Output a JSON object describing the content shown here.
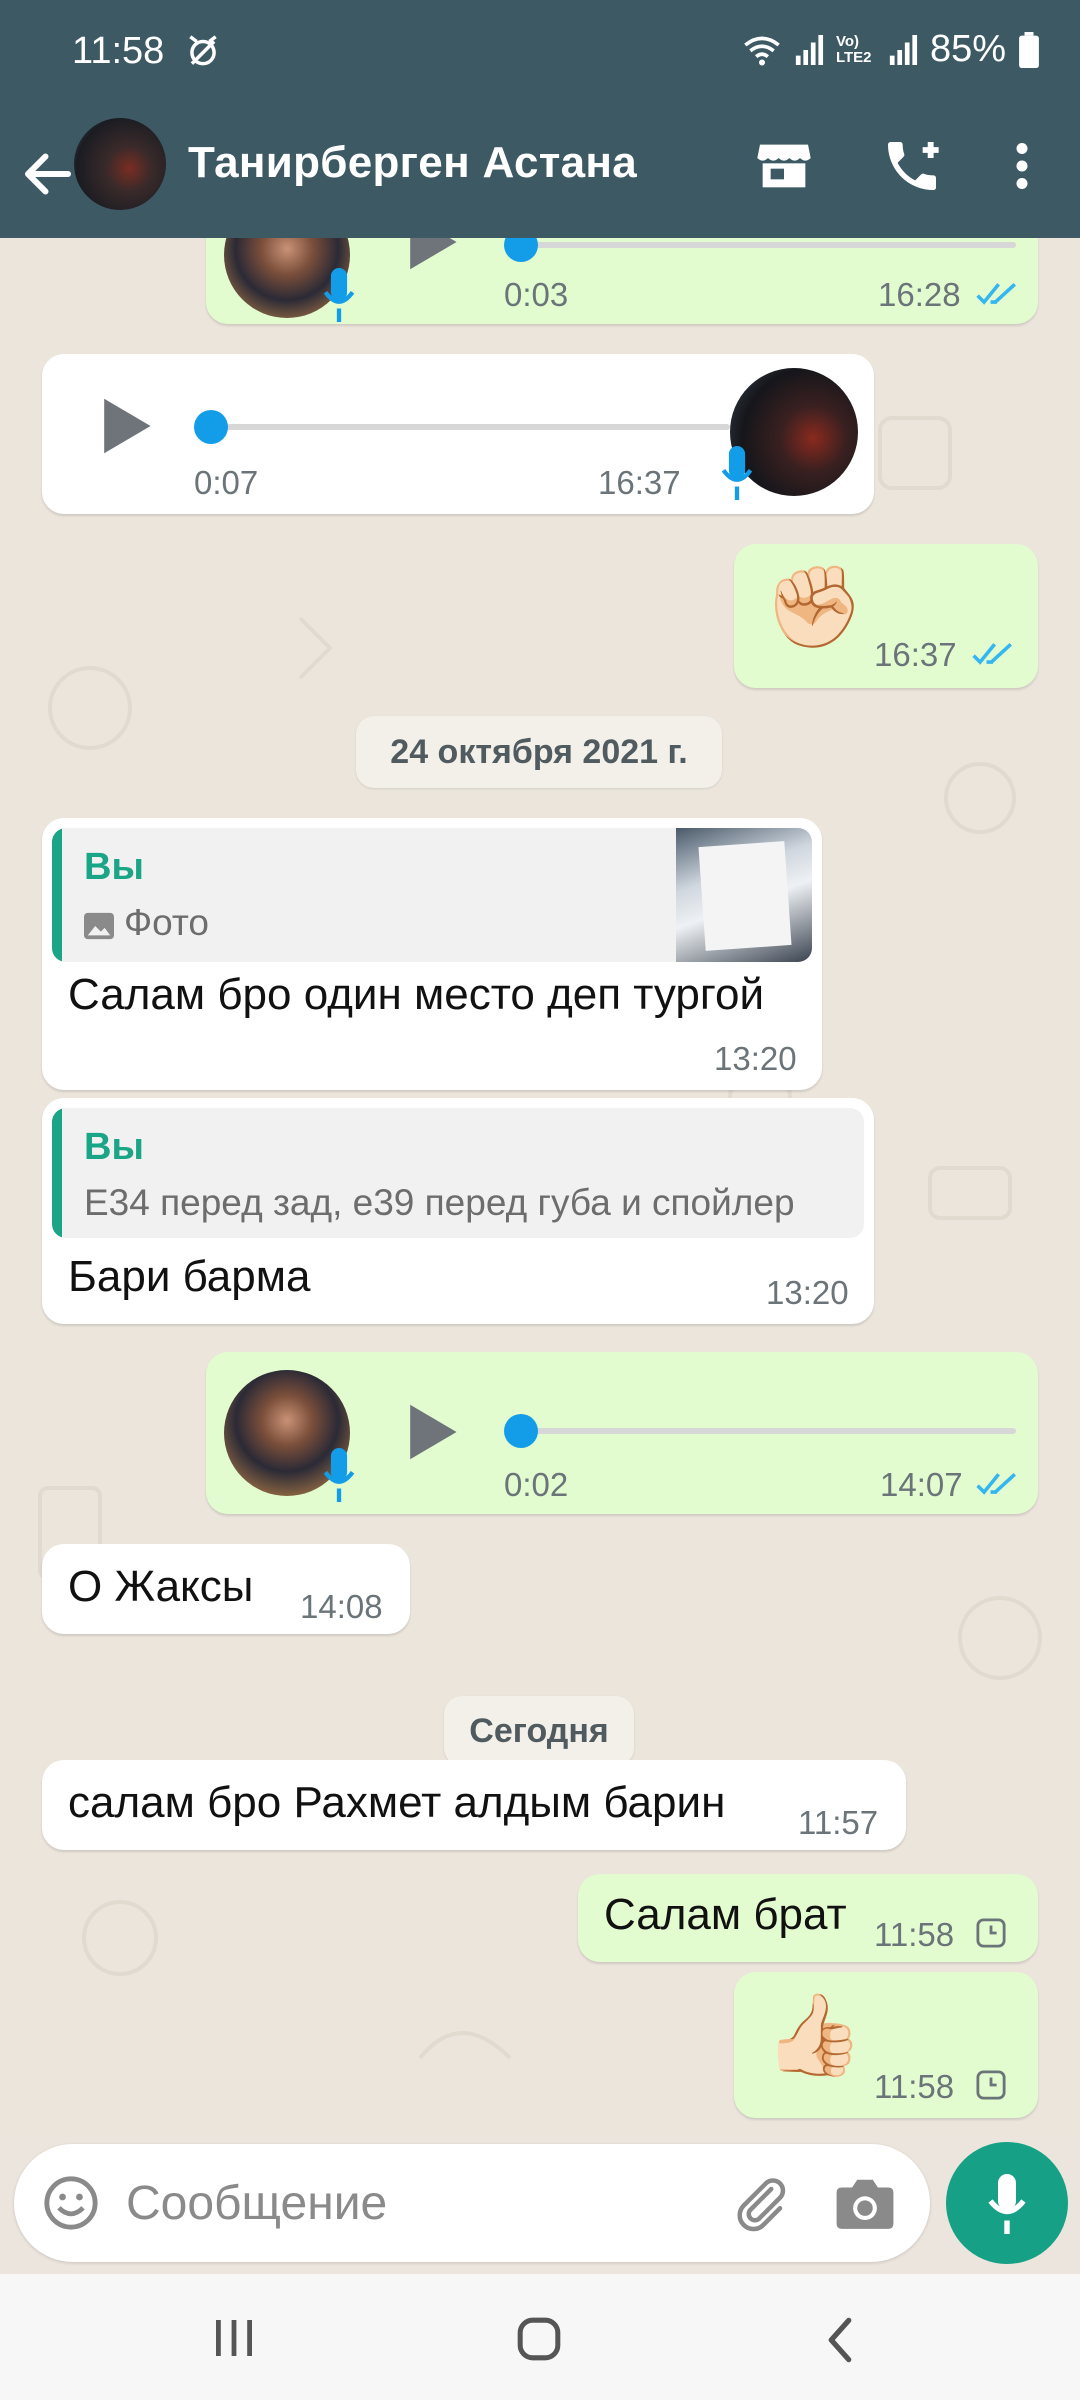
{
  "status_bar": {
    "time": "11:58",
    "network_label": "Vo) LTE2",
    "battery": "85%"
  },
  "header": {
    "contact_name": "Танирберген Астана",
    "icons": [
      "back-arrow-icon",
      "store-icon",
      "add-call-icon",
      "more-vert-icon"
    ]
  },
  "messages": {
    "m1": {
      "duration": "0:03",
      "time": "16:28"
    },
    "m2": {
      "duration": "0:07",
      "time": "16:37"
    },
    "m3": {
      "emoji": "✊🏻",
      "time": "16:37"
    },
    "date1": "24 октября 2021 г.",
    "m4": {
      "quote_author": "Вы",
      "quote_text": "Фото",
      "text": "Салам бро один место деп тургой",
      "time": "13:20"
    },
    "m5": {
      "quote_author": "Вы",
      "quote_text": "E34 перед зад, е39 перед губа и спойлер",
      "text": "Бари барма",
      "time": "13:20"
    },
    "m6": {
      "duration": "0:02",
      "time": "14:07"
    },
    "m7": {
      "text": "О Жаксы",
      "time": "14:08"
    },
    "date2": "Сегодня",
    "m8": {
      "text": "салам бро Рахмет алдым барин",
      "time": "11:57"
    },
    "m9": {
      "text": "Салам брат",
      "time": "11:58"
    },
    "m10": {
      "emoji": "👍🏻",
      "time": "11:58"
    }
  },
  "composer": {
    "placeholder": "Сообщение"
  },
  "colors": {
    "header": "#3d5a64",
    "outgoing_bubble": "#e3fccf",
    "incoming_bubble": "#ffffff",
    "accent": "#16a085",
    "read_ticks": "#34b7f1"
  }
}
